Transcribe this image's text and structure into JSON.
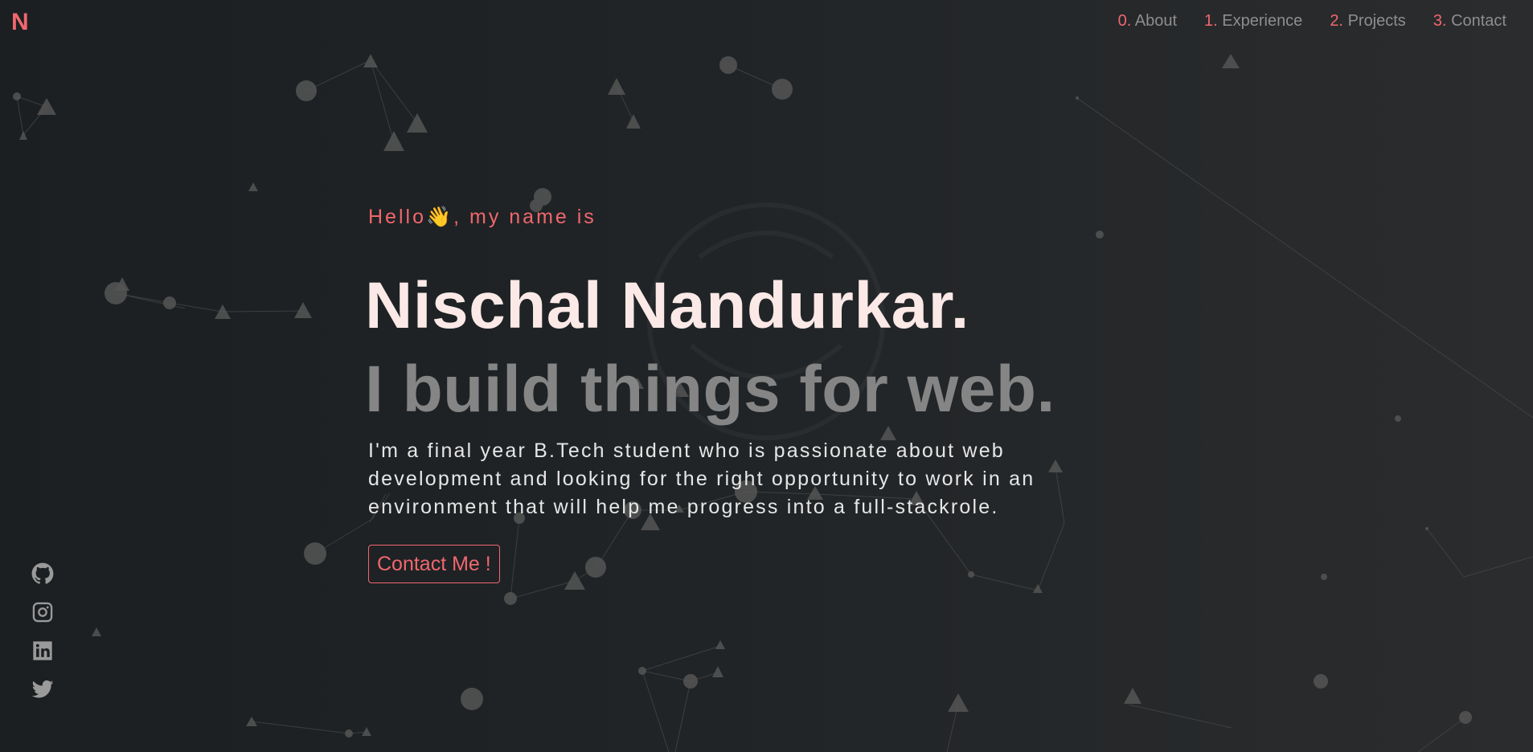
{
  "logo": "N",
  "nav": [
    {
      "num": "0.",
      "label": "About"
    },
    {
      "num": "1.",
      "label": "Experience"
    },
    {
      "num": "2.",
      "label": "Projects"
    },
    {
      "num": "3.",
      "label": "Contact"
    }
  ],
  "hero": {
    "greeting": "Hello👋, my name is",
    "name": "Nischal Nandurkar.",
    "tagline": "I build things for web.",
    "bio": "I'm a final year B.Tech student who is passionate about web development and looking for the right opportunity to work in an environment that will help me progress into a full-stackrole.",
    "cta_label": "Contact Me !"
  },
  "socials": [
    {
      "icon": "github-icon"
    },
    {
      "icon": "instagram-icon"
    },
    {
      "icon": "linkedin-icon"
    },
    {
      "icon": "twitter-icon"
    }
  ],
  "colors": {
    "accent": "#f0676e",
    "name": "#fbe9e7",
    "tagline": "#858585",
    "nav_text": "#8e8e8e",
    "background": "#1f2325",
    "particles": "#5a5a5a"
  }
}
